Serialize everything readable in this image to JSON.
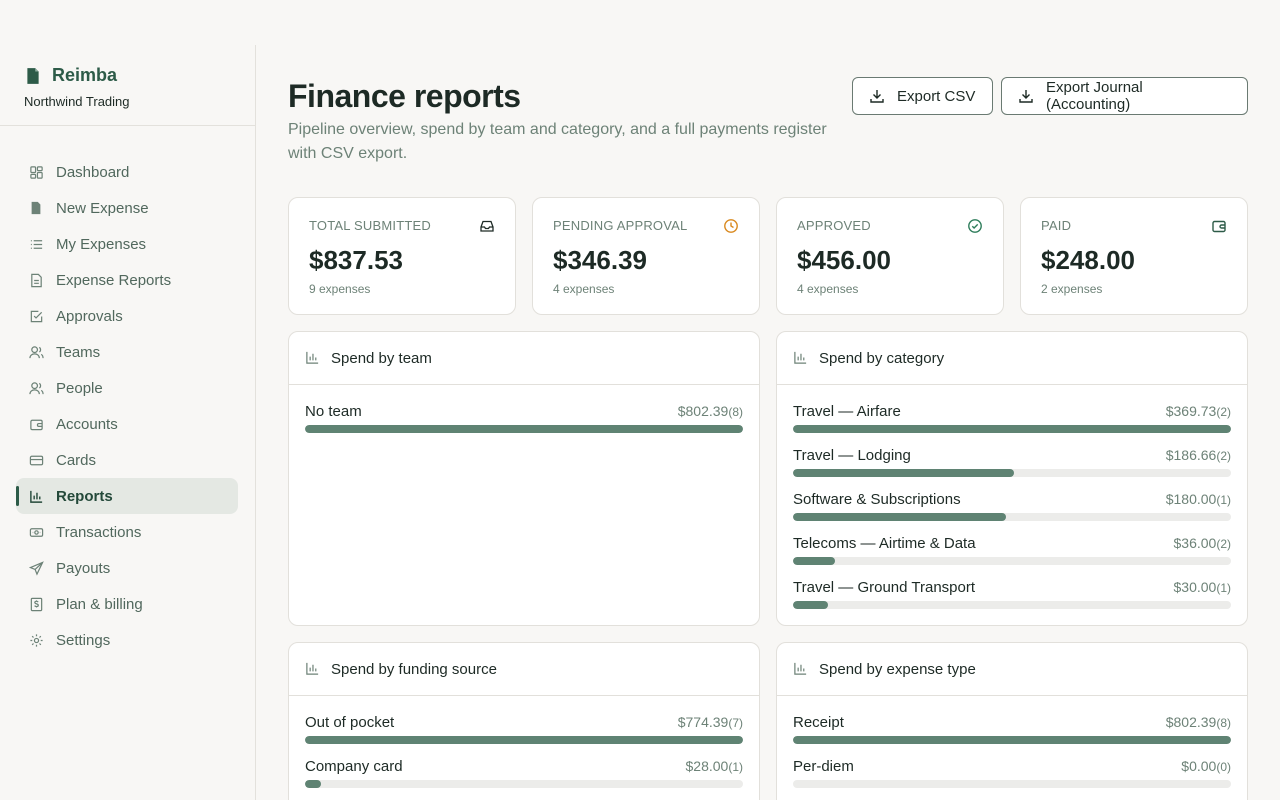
{
  "brand": {
    "name": "Reimba",
    "org": "Northwind Trading"
  },
  "nav": [
    {
      "label": "Dashboard",
      "icon": "grid-icon"
    },
    {
      "label": "New Expense",
      "icon": "file-icon"
    },
    {
      "label": "My Expenses",
      "icon": "list-icon"
    },
    {
      "label": "Expense Reports",
      "icon": "document-icon"
    },
    {
      "label": "Approvals",
      "icon": "check-square-icon"
    },
    {
      "label": "Teams",
      "icon": "users-icon"
    },
    {
      "label": "People",
      "icon": "people-icon"
    },
    {
      "label": "Accounts",
      "icon": "wallet-icon"
    },
    {
      "label": "Cards",
      "icon": "card-icon"
    },
    {
      "label": "Reports",
      "icon": "bar-chart-icon",
      "active": true
    },
    {
      "label": "Transactions",
      "icon": "banknote-icon"
    },
    {
      "label": "Payouts",
      "icon": "send-icon"
    },
    {
      "label": "Plan & billing",
      "icon": "receipt-dollar-icon"
    },
    {
      "label": "Settings",
      "icon": "gear-icon"
    }
  ],
  "header": {
    "title": "Finance reports",
    "subtitle": "Pipeline overview, spend by team and category, and a full payments register with CSV export.",
    "export_csv": "Export CSV",
    "export_journal": "Export Journal (Accounting)"
  },
  "stats": [
    {
      "label": "Total submitted",
      "value": "$837.53",
      "sub": "9 expenses",
      "icon": "inbox-icon",
      "color": "#1d2a25"
    },
    {
      "label": "Pending approval",
      "value": "$346.39",
      "sub": "4 expenses",
      "icon": "clock-icon",
      "color": "#d9891f"
    },
    {
      "label": "Approved",
      "value": "$456.00",
      "sub": "4 expenses",
      "icon": "check-circle-icon",
      "color": "#2e7d5b"
    },
    {
      "label": "Paid",
      "value": "$248.00",
      "sub": "2 expenses",
      "icon": "wallet-icon",
      "color": "#2d5b48"
    }
  ],
  "panels": [
    {
      "title": "Spend by team",
      "rows": [
        {
          "label": "No team",
          "amount": "$802.39",
          "count": "(8)",
          "share": 100
        }
      ]
    },
    {
      "title": "Spend by category",
      "rows": [
        {
          "label": "Travel — Airfare",
          "amount": "$369.73",
          "count": "(2)",
          "share": 100
        },
        {
          "label": "Travel — Lodging",
          "amount": "$186.66",
          "count": "(2)",
          "share": 50.5
        },
        {
          "label": "Software & Subscriptions",
          "amount": "$180.00",
          "count": "(1)",
          "share": 48.7
        },
        {
          "label": "Telecoms — Airtime & Data",
          "amount": "$36.00",
          "count": "(2)",
          "share": 9.7
        },
        {
          "label": "Travel — Ground Transport",
          "amount": "$30.00",
          "count": "(1)",
          "share": 8.1
        }
      ]
    },
    {
      "title": "Spend by funding source",
      "rows": [
        {
          "label": "Out of pocket",
          "amount": "$774.39",
          "count": "(7)",
          "share": 100
        },
        {
          "label": "Company card",
          "amount": "$28.00",
          "count": "(1)",
          "share": 3.6
        }
      ]
    },
    {
      "title": "Spend by expense type",
      "rows": [
        {
          "label": "Receipt",
          "amount": "$802.39",
          "count": "(8)",
          "share": 100
        },
        {
          "label": "Per-diem",
          "amount": "$0.00",
          "count": "(0)",
          "share": 0
        }
      ]
    }
  ],
  "colors": {
    "accent": "#2d5b48",
    "bar": "#5f8373",
    "track": "#ececea"
  }
}
